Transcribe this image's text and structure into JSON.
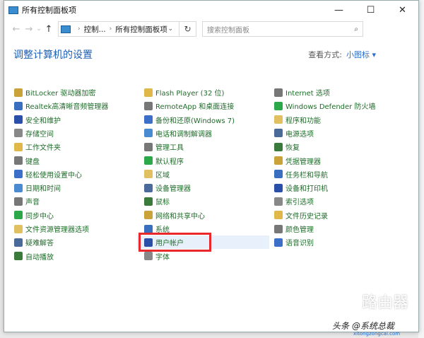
{
  "window": {
    "title": "所有控制面板项",
    "minimize": "—",
    "maximize": "☐",
    "close": "✕"
  },
  "nav": {
    "back": "←",
    "forward": "→",
    "recent": "⌄",
    "up": "↑",
    "breadcrumb": [
      "控制...",
      "所有控制面板项"
    ],
    "refresh": "↻",
    "search_placeholder": "搜索控制面板",
    "search_icon": "⌕"
  },
  "header": {
    "title": "调整计算机的设置",
    "view_label": "查看方式:",
    "view_value": "小图标 ▾"
  },
  "columns": [
    [
      "BitLocker 驱动器加密",
      "Realtek高清晰音频管理器",
      "安全和维护",
      "存储空间",
      "工作文件夹",
      "键盘",
      "轻松使用设置中心",
      "日期和时间",
      "声音",
      "同步中心",
      "文件资源管理器选项",
      "疑难解答",
      "自动播放"
    ],
    [
      "Flash Player (32 位)",
      "RemoteApp 和桌面连接",
      "备份和还原(Windows 7)",
      "电话和调制解调器",
      "管理工具",
      "默认程序",
      "区域",
      "设备管理器",
      "鼠标",
      "网络和共享中心",
      "系统",
      "用户帐户",
      "字体"
    ],
    [
      "Internet 选项",
      "Windows Defender 防火墙",
      "程序和功能",
      "电源选项",
      "恢复",
      "凭据管理器",
      "任务栏和导航",
      "设备和打印机",
      "索引选项",
      "文件历史记录",
      "颜色管理",
      "语音识别"
    ]
  ],
  "icon_colors": [
    "#c9a23a",
    "#3a6fc0",
    "#2a4fa8",
    "#888888",
    "#e0b84a",
    "#777777",
    "#3b6fc8",
    "#4a8ad0",
    "#777777",
    "#2aa84a",
    "#e0c060",
    "#4a6a9a",
    "#3a7a3a"
  ],
  "watermark": {
    "logo_text": "路由器",
    "credit": "头条 @系统总裁",
    "url": "xitongzongcai.com"
  }
}
